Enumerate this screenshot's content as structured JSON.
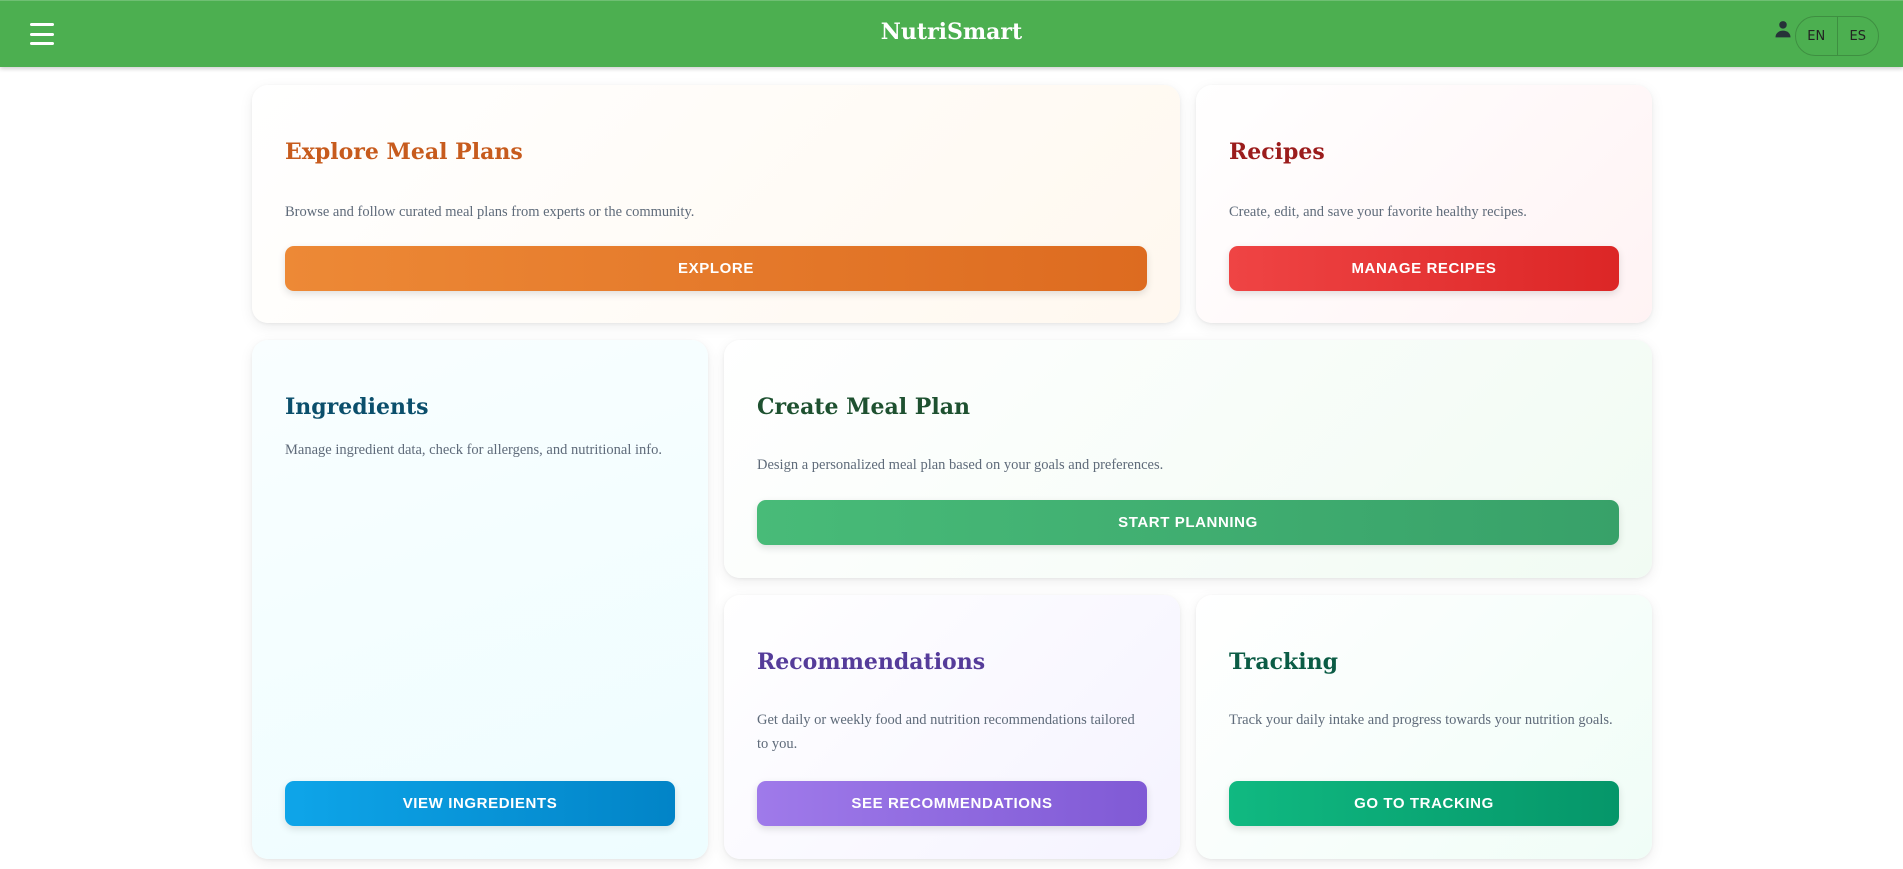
{
  "app": {
    "brand": "NutriSmart",
    "languages": [
      "EN",
      "ES"
    ],
    "icons": {
      "menu": "hamburger-menu-icon",
      "user": "account-person-icon"
    }
  },
  "cards": {
    "explore": {
      "title": "Explore Meal Plans",
      "description": "Browse and follow curated meal plans from experts or the community.",
      "button": "EXPLORE"
    },
    "recipes": {
      "title": "Recipes",
      "description": "Create, edit, and save your favorite healthy recipes.",
      "button": "MANAGE RECIPES"
    },
    "ingredients": {
      "title": "Ingredients",
      "description": "Manage ingredient data, check for allergens, and nutritional info.",
      "button": "VIEW INGREDIENTS"
    },
    "create": {
      "title": "Create Meal Plan",
      "description": "Design a personalized meal plan based on your goals and preferences.",
      "button": "START PLANNING"
    },
    "recommendations": {
      "title": "Recommendations",
      "description": "Get daily or weekly food and nutrition recommendations tailored to you.",
      "button": "SEE RECOMMENDATIONS"
    },
    "tracking": {
      "title": "Tracking",
      "description": "Track your daily intake and progress towards your nutrition goals.",
      "button": "GO TO TRACKING"
    }
  },
  "colors": {
    "appbar": "#4caf50",
    "explore": "#dd6b20",
    "recipes": "#dc2626",
    "ingredients": "#0284c7",
    "create": "#38a169",
    "recommendations": "#805ad5",
    "tracking": "#059669"
  }
}
